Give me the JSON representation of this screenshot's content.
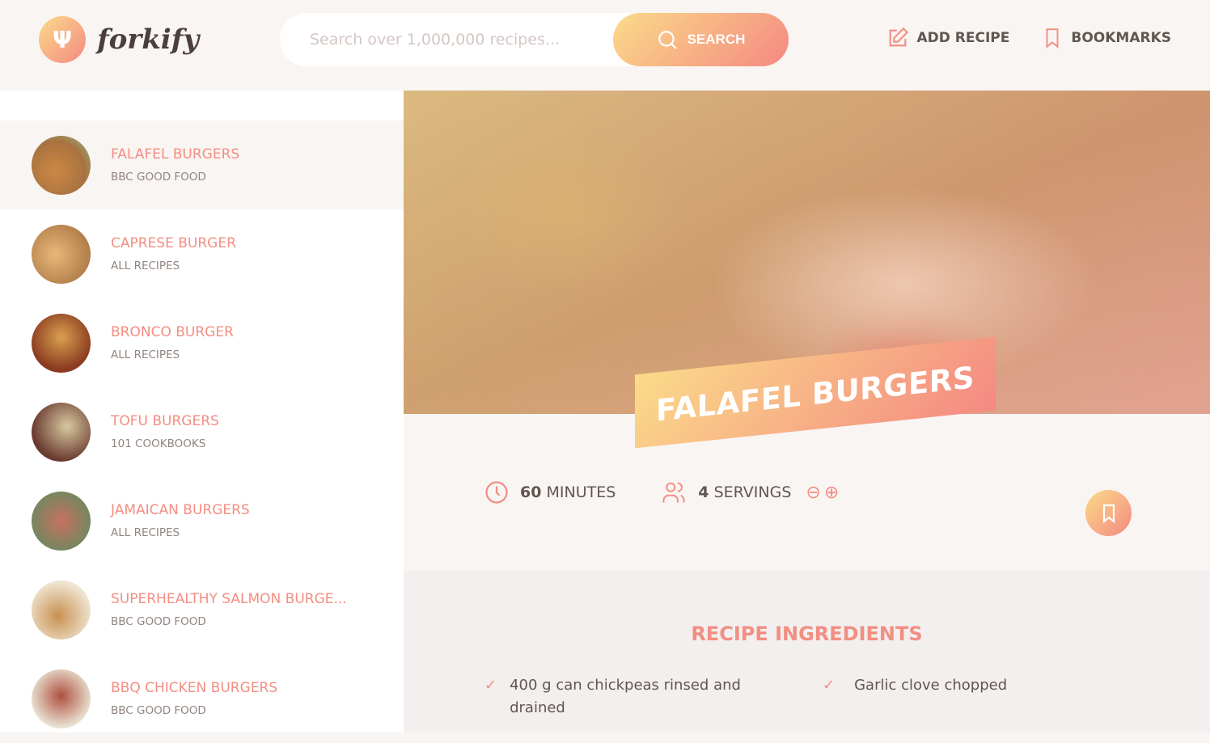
{
  "header": {
    "logo_text": "forkify",
    "search_placeholder": "Search over 1,000,000 recipes...",
    "search_label": "SEARCH",
    "nav": [
      {
        "label": "ADD RECIPE",
        "icon": "edit-icon"
      },
      {
        "label": "BOOKMARKS",
        "icon": "bookmark-icon"
      }
    ]
  },
  "results": [
    {
      "title": "FALAFEL BURGERS",
      "publisher": "BBC GOOD FOOD",
      "active": true
    },
    {
      "title": "CAPRESE BURGER",
      "publisher": "ALL RECIPES"
    },
    {
      "title": "BRONCO BURGER",
      "publisher": "ALL RECIPES"
    },
    {
      "title": "TOFU BURGERS",
      "publisher": "101 COOKBOOKS"
    },
    {
      "title": "JAMAICAN BURGERS",
      "publisher": "ALL RECIPES"
    },
    {
      "title": "SUPERHEALTHY SALMON BURGE...",
      "publisher": "BBC GOOD FOOD"
    },
    {
      "title": "BBQ CHICKEN BURGERS",
      "publisher": "BBC GOOD FOOD"
    }
  ],
  "recipe": {
    "title": "FALAFEL BURGERS",
    "minutes": "60",
    "minutes_label": "MINUTES",
    "servings": "4",
    "servings_label": "SERVINGS",
    "ingredients_title": "RECIPE INGREDIENTS",
    "ingredients": [
      {
        "qty": "400 g",
        "desc": "can chickpeas rinsed and drained"
      },
      {
        "qty": "",
        "desc": "Garlic clove chopped"
      }
    ]
  },
  "colors": {
    "accent": "#f38e82",
    "accent_light": "#fbdb89"
  }
}
